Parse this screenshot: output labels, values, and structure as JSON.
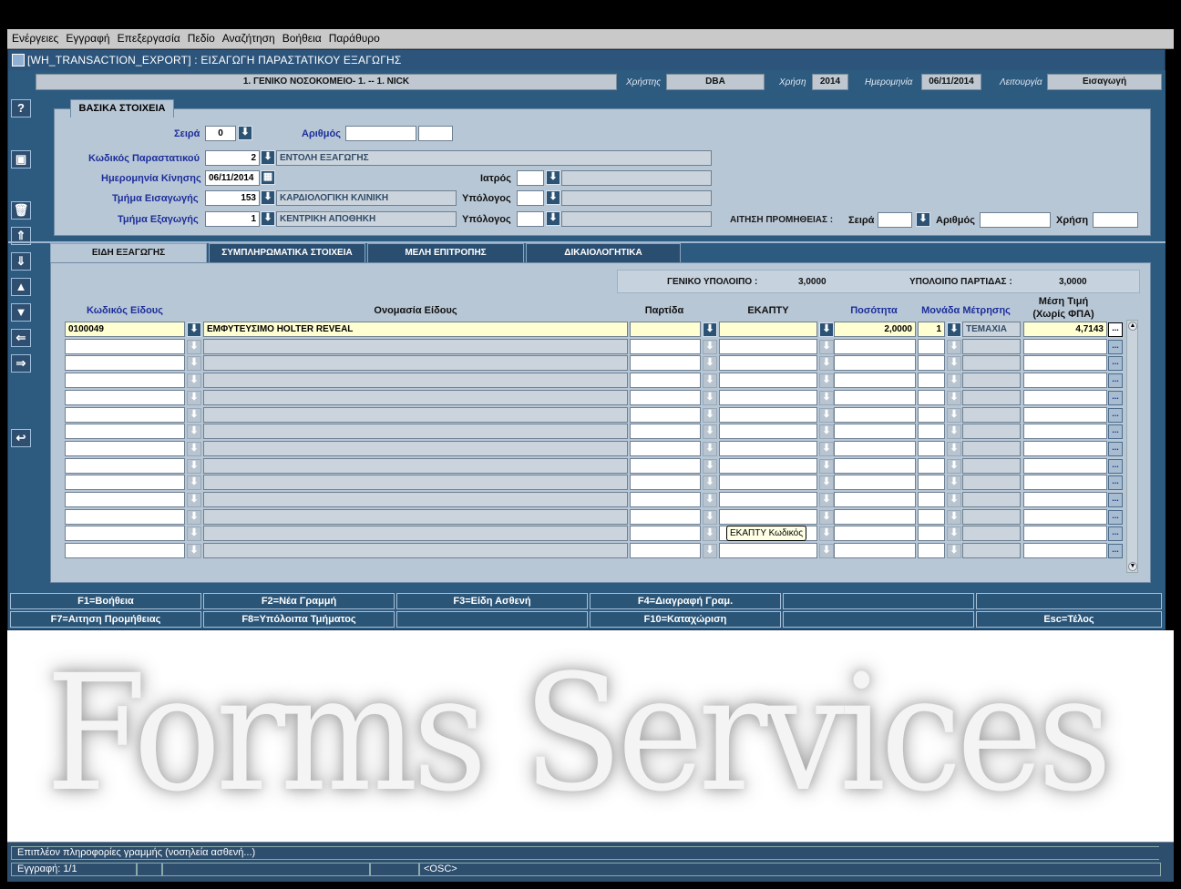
{
  "menu": [
    "Ενέργειες",
    "Εγγραφή",
    "Επεξεργασία",
    "Πεδίο",
    "Αναζήτηση",
    "Βοήθεια",
    "Παράθυρο"
  ],
  "window": {
    "title": "[WH_TRANSACTION_EXPORT]  :  ΕΙΣΑΓΩΓΗ ΠΑΡΑΣΤΑΤΙΚΟΥ ΕΞΑΓΩΓΗΣ"
  },
  "header": {
    "org": "1. ΓΕΝΙΚΟ ΝΟΣΟΚΟΜΕΙΟ- 1. -- 1. NICK",
    "user_label": "Χρήστης",
    "user": "DBA",
    "year_label": "Χρήση",
    "year": "2014",
    "date_label": "Ημερομηνία",
    "date": "06/11/2014",
    "mode_label": "Λειτουργία",
    "mode": "Εισαγωγή"
  },
  "basic": {
    "title": "ΒΑΣΙΚΑ ΣΤΟΙΧΕΙΑ",
    "seira_label": "Σειρά",
    "seira": "0",
    "arithmos_label": "Αριθμός",
    "arithmos": "",
    "arithmos2": "",
    "doc_label": "Κωδικός Παραστατικού",
    "doc_code": "2",
    "doc_name": "ΕΝΤΟΛΗ ΕΞΑΓΩΓΗΣ",
    "move_date_label": "Ημερομηνία Κίνησης",
    "move_date": "06/11/2014",
    "doctor_label": "Ιατρός",
    "doctor_code": "",
    "doctor_name": "",
    "dept_in_label": "Τμήμα Εισαγωγής",
    "dept_in_code": "153",
    "dept_in_name": "ΚΑΡΔΙΟΛΟΓΙΚΗ ΚΛΙΝΙΚΗ",
    "resp1_label": "Υπόλογος",
    "dept_out_label": "Τμήμα Εξαγωγής",
    "dept_out_code": "1",
    "dept_out_name": "ΚΕΝΤΡΙΚΗ ΑΠΟΘΗΚΗ",
    "resp2_label": "Υπόλογος",
    "req_label": "ΑΙΤΗΣΗ ΠΡΟΜΗΘΕΙΑΣ :",
    "req_seira_label": "Σειρά",
    "req_arithmos_label": "Αριθμός",
    "req_xrisi_label": "Χρήση"
  },
  "tabs": [
    "ΕΙΔΗ ΕΞΑΓΩΓΗΣ",
    "ΣΥΜΠΛΗΡΩΜΑΤΙΚΑ ΣΤΟΙΧΕΙΑ",
    "ΜΕΛΗ ΕΠΙΤΡΟΠΗΣ",
    "ΔΙΚΑΙΟΛΟΓΗΤΙΚΑ"
  ],
  "balances": {
    "general_label": "ΓΕΝΙΚΟ ΥΠΟΛΟΙΠΟ :",
    "general": "3,0000",
    "batch_label": "ΥΠΟΛΟΙΠΟ ΠΑΡΤΙΔΑΣ :",
    "batch": "3,0000"
  },
  "columns": {
    "code": "Κωδικός Είδους",
    "name": "Ονομασία Είδους",
    "batch": "Παρτίδα",
    "ekapty": "ΕΚΑΠΤΥ",
    "qty": "Ποσότητα",
    "unit": "Μονάδα Μέτρησης",
    "price1": "Μέση Τιμή",
    "price2": "(Χωρίς ΦΠΑ)"
  },
  "rows": [
    {
      "code": "0100049",
      "name": "ΕΜΦΥΤΕΥΣΙΜΟ HOLTER  REVEAL",
      "batch": "",
      "ekapty": "",
      "qty": "2,0000",
      "unit_code": "1",
      "unit": "ΤΕΜΑΧΙΑ",
      "price": "4,7143"
    }
  ],
  "tooltip": "ΕΚΑΠΤΥ Κωδικός",
  "fkeys": [
    "F1=Βοήθεια",
    "F2=Νέα Γραμμή",
    "F3=Είδη Ασθενή",
    "F4=Διαγραφή Γραμ.",
    "",
    "",
    "F7=Αιτηση Προμήθειας",
    "F8=Υπόλοιπα Τμήματος",
    "",
    "F10=Καταχώριση",
    "",
    "Esc=Τέλος"
  ],
  "watermark": "Forms Services",
  "status": {
    "line1": "Επιπλέον πληροφορίες γραμμής (νοσηλεία ασθενή...)",
    "record": "Εγγραφή: 1/1",
    "osc": "<OSC>"
  }
}
